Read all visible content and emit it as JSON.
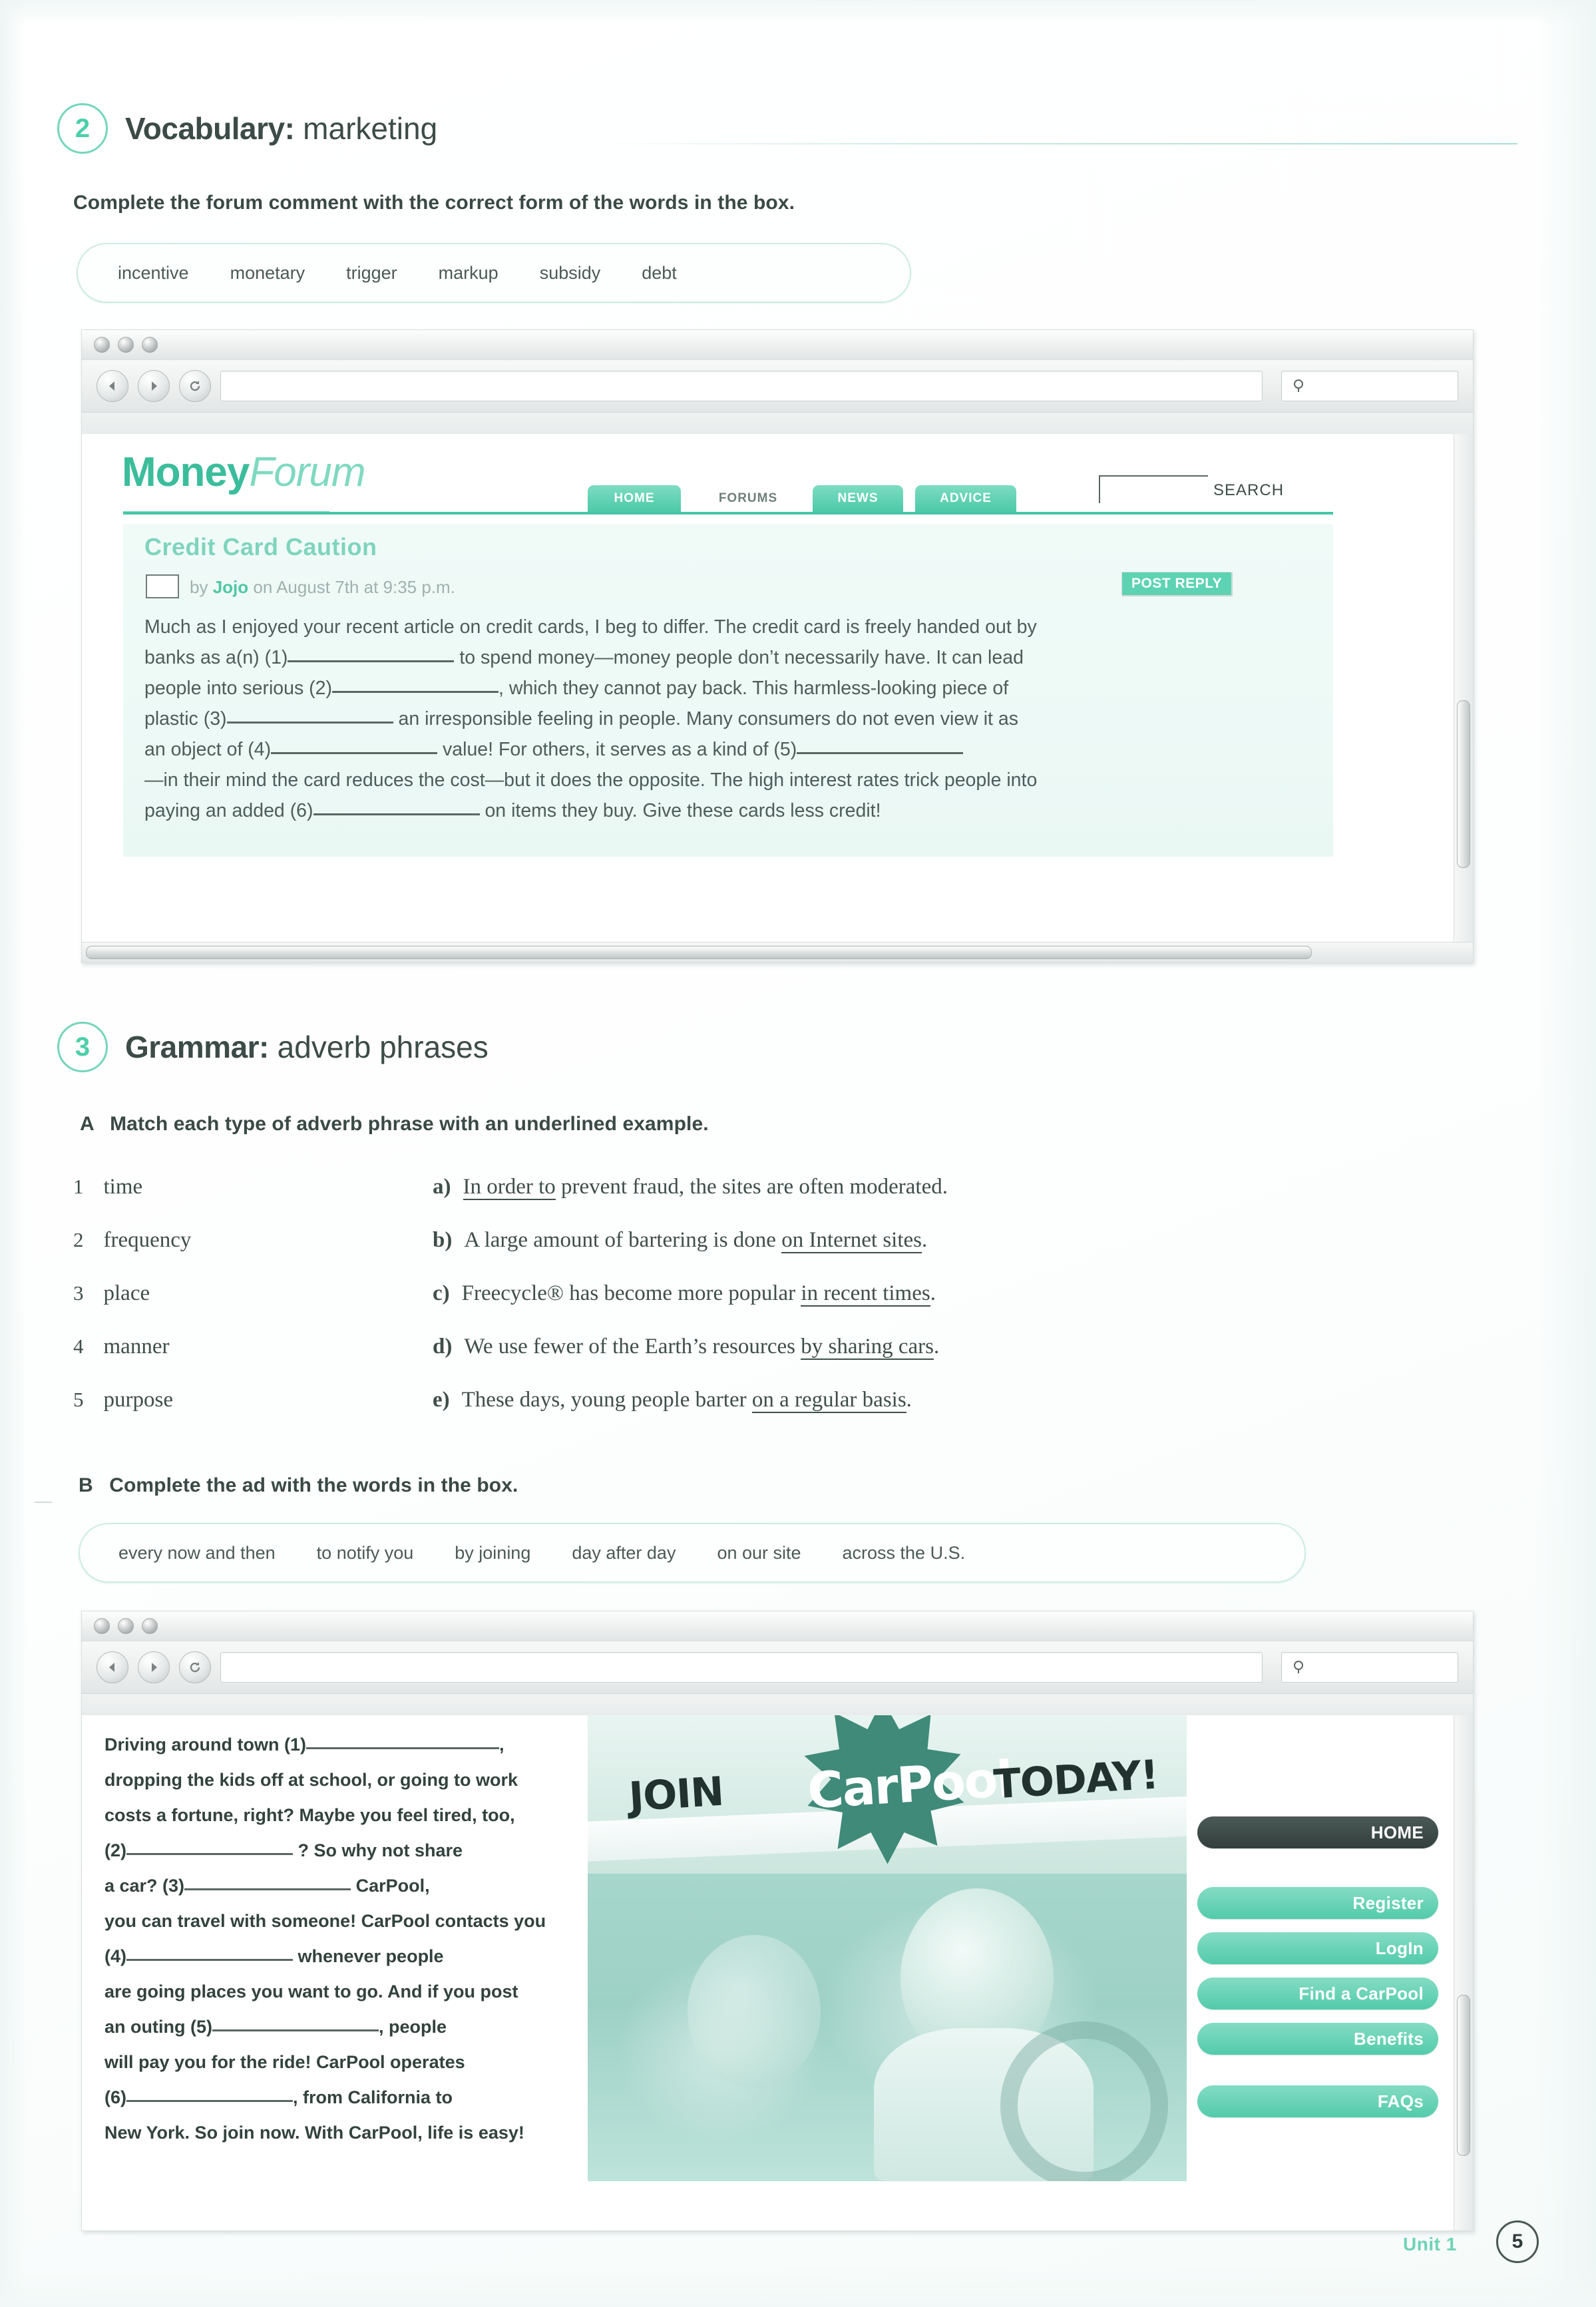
{
  "page": {
    "footer_unit": "Unit 1",
    "footer_page": "5"
  },
  "section2": {
    "number": "2",
    "title_bold": "Vocabulary:",
    "title_light": " marketing",
    "instruction": "Complete the forum comment with the correct form of the words in the box.",
    "wordbox": [
      "incentive",
      "monetary",
      "trigger",
      "markup",
      "subsidy",
      "debt"
    ],
    "browser": {
      "url_value": "",
      "url_placeholder": "",
      "search_placeholder": "",
      "search_icon": "search-icon"
    },
    "forum": {
      "logo_part1": "Money",
      "logo_part2": "Forum",
      "nav": [
        "HOME",
        "FORUMS",
        "NEWS",
        "ADVICE"
      ],
      "search_label": "SEARCH",
      "post_title": "Credit Card Caution",
      "byline_by": "by ",
      "byline_author": "Jojo",
      "byline_rest": " on August 7th at 9:35 p.m.",
      "post_reply": "POST REPLY",
      "body": [
        {
          "t": "Much as I enjoyed your recent article on credit cards, I beg to differ. The credit card is freely handed out by"
        },
        {
          "t": "banks as a(n) (1)",
          "blank": 250,
          "t2": " to spend money—money people don’t necessarily have. It can lead"
        },
        {
          "t": "people into serious (2)",
          "blank": 250,
          "t2": ", which they cannot pay back. This harmless-looking piece of"
        },
        {
          "t": "plastic (3)",
          "blank": 250,
          "t2": " an irresponsible feeling in people. Many consumers do not even view it as"
        },
        {
          "t": "an object of (4)",
          "blank": 250,
          "t2": " value! For others, it serves as a kind of (5)",
          "blank2": 250
        },
        {
          "t": "—in their mind the card reduces the cost—but it does the opposite. The high interest rates trick people into"
        },
        {
          "t": "paying an added (6)",
          "blank": 250,
          "t2": " on items they buy. Give these cards less credit!"
        }
      ]
    }
  },
  "section3": {
    "number": "3",
    "title_bold": "Grammar:",
    "title_light": " adverb phrases",
    "partA": {
      "letter": "A",
      "instruction": "Match each type of adverb phrase with an underlined example.",
      "left": [
        {
          "num": "1",
          "label": "time"
        },
        {
          "num": "2",
          "label": "frequency"
        },
        {
          "num": "3",
          "label": "place"
        },
        {
          "num": "4",
          "label": "manner"
        },
        {
          "num": "5",
          "label": "purpose"
        }
      ],
      "right": [
        {
          "letter": "a)",
          "pre": "",
          "underline": "In order to",
          "post": " prevent fraud, the sites are often moderated."
        },
        {
          "letter": "b)",
          "pre": "A large amount of bartering is done ",
          "underline": "on Internet sites",
          "post": "."
        },
        {
          "letter": "c)",
          "pre": "Freecycle® has become more popular ",
          "underline": "in recent times",
          "post": "."
        },
        {
          "letter": "d)",
          "pre": "We use fewer of the Earth’s resources ",
          "underline": "by sharing cars",
          "post": "."
        },
        {
          "letter": "e)",
          "pre": "These days, young people barter ",
          "underline": "on a regular basis",
          "post": "."
        }
      ]
    },
    "partB": {
      "letter": "B",
      "instruction": "Complete the ad with the words in the box.",
      "wordbox": [
        "every now and then",
        "to notify you",
        "by joining",
        "day after day",
        "on our site",
        "across the U.S."
      ],
      "browser": {
        "url_value": "",
        "search_icon": "search-icon"
      },
      "ad": {
        "lines": [
          {
            "t": "Driving around town (1)",
            "blank": 290,
            "t2": ","
          },
          {
            "t": "dropping the kids off at school, or going to work"
          },
          {
            "t": "costs a fortune, right? Maybe you feel tired, too,"
          },
          {
            "t": "(2)",
            "blank": 250,
            "t2": " ? So why not share"
          },
          {
            "t": "a car? (3)",
            "blank": 250,
            "t2": " CarPool,"
          },
          {
            "t": "you can travel with someone! CarPool contacts you"
          },
          {
            "t": "(4)",
            "blank": 250,
            "t2": " whenever people"
          },
          {
            "t": "are going places you want to go. And if you post"
          },
          {
            "t": "an outing (5)",
            "blank": 250,
            "t2": ", people"
          },
          {
            "t": "will pay you for the ride! CarPool operates"
          },
          {
            "t": "(6)",
            "blank": 250,
            "t2": ", from California to"
          },
          {
            "t": "New York. So join now. With CarPool, life is easy!"
          }
        ],
        "banner_join": "JOIN",
        "banner_word": "CarPool",
        "banner_today": "TODAY!",
        "nav": [
          {
            "label": "HOME",
            "active": true
          },
          {
            "label": "Register",
            "active": false
          },
          {
            "label": "LogIn",
            "active": false
          },
          {
            "label": "Find a CarPool",
            "active": false
          },
          {
            "label": "Benefits",
            "active": false
          },
          {
            "label": "FAQs",
            "active": false
          }
        ]
      }
    }
  },
  "colors": {
    "accent_teal": "#4cc9a8",
    "accent_light": "#7fd9c1",
    "text": "#3c4b47",
    "dark_btn": "#323f3c"
  }
}
